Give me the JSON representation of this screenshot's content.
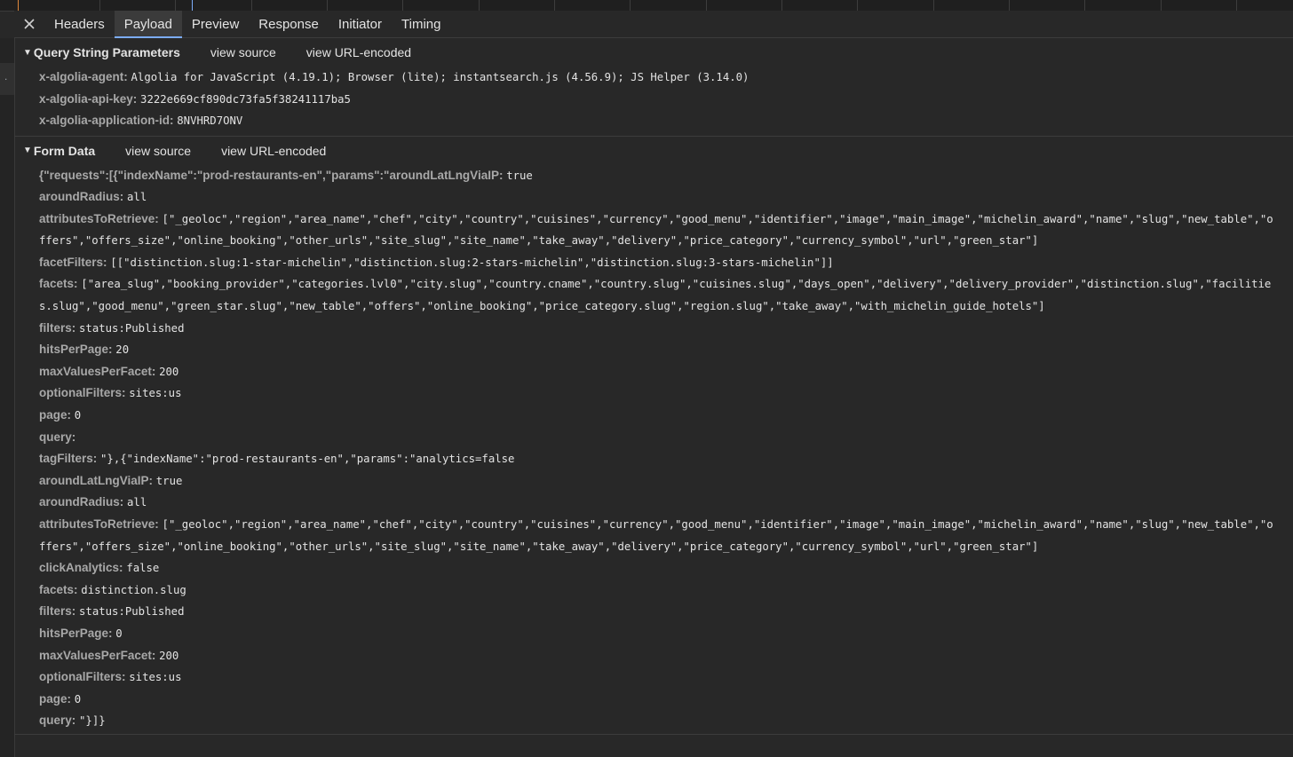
{
  "tabs": {
    "close_icon": "close-icon",
    "items": [
      "Headers",
      "Payload",
      "Preview",
      "Response",
      "Initiator",
      "Timing"
    ],
    "active": "Payload"
  },
  "query_string": {
    "title": "Query String Parameters",
    "view_source": "view source",
    "view_url_encoded": "view URL-encoded",
    "params": [
      {
        "key": "x-algolia-agent:",
        "value": "Algolia for JavaScript (4.19.1); Browser (lite); instantsearch.js (4.56.9); JS Helper (3.14.0)"
      },
      {
        "key": "x-algolia-api-key:",
        "value": "3222e669cf890dc73fa5f38241117ba5"
      },
      {
        "key": "x-algolia-application-id:",
        "value": "8NVHRD7ONV"
      }
    ]
  },
  "form_data": {
    "title": "Form Data",
    "view_source": "view source",
    "view_url_encoded": "view URL-encoded",
    "rows": [
      {
        "key": "{\"requests\":[{\"indexName\":\"prod-restaurants-en\",\"params\":\"aroundLatLngViaIP:",
        "value": "true"
      },
      {
        "key": "aroundRadius:",
        "value": "all"
      },
      {
        "key": "attributesToRetrieve:",
        "value": "[\"_geoloc\",\"region\",\"area_name\",\"chef\",\"city\",\"country\",\"cuisines\",\"currency\",\"good_menu\",\"identifier\",\"image\",\"main_image\",\"michelin_award\",\"name\",\"slug\",\"new_table\",\"o",
        "cont": "ffers\",\"offers_size\",\"online_booking\",\"other_urls\",\"site_slug\",\"site_name\",\"take_away\",\"delivery\",\"price_category\",\"currency_symbol\",\"url\",\"green_star\"]"
      },
      {
        "key": "facetFilters:",
        "value": "[[\"distinction.slug:1-star-michelin\",\"distinction.slug:2-stars-michelin\",\"distinction.slug:3-stars-michelin\"]]"
      },
      {
        "key": "facets:",
        "value": "[\"area_slug\",\"booking_provider\",\"categories.lvl0\",\"city.slug\",\"country.cname\",\"country.slug\",\"cuisines.slug\",\"days_open\",\"delivery\",\"delivery_provider\",\"distinction.slug\",\"facilitie",
        "cont": "s.slug\",\"good_menu\",\"green_star.slug\",\"new_table\",\"offers\",\"online_booking\",\"price_category.slug\",\"region.slug\",\"take_away\",\"with_michelin_guide_hotels\"]"
      },
      {
        "key": "filters:",
        "value": "status:Published"
      },
      {
        "key": "hitsPerPage:",
        "value": "20"
      },
      {
        "key": "maxValuesPerFacet:",
        "value": "200"
      },
      {
        "key": "optionalFilters:",
        "value": "sites:us"
      },
      {
        "key": "page:",
        "value": "0"
      },
      {
        "key": "query:",
        "value": ""
      },
      {
        "key": "tagFilters:",
        "value": "\"},{\"indexName\":\"prod-restaurants-en\",\"params\":\"analytics=false"
      },
      {
        "key": "aroundLatLngViaIP:",
        "value": "true"
      },
      {
        "key": "aroundRadius:",
        "value": "all"
      },
      {
        "key": "attributesToRetrieve:",
        "value": "[\"_geoloc\",\"region\",\"area_name\",\"chef\",\"city\",\"country\",\"cuisines\",\"currency\",\"good_menu\",\"identifier\",\"image\",\"main_image\",\"michelin_award\",\"name\",\"slug\",\"new_table\",\"o",
        "cont": "ffers\",\"offers_size\",\"online_booking\",\"other_urls\",\"site_slug\",\"site_name\",\"take_away\",\"delivery\",\"price_category\",\"currency_symbol\",\"url\",\"green_star\"]"
      },
      {
        "key": "clickAnalytics:",
        "value": "false"
      },
      {
        "key": "facets:",
        "value": "distinction.slug"
      },
      {
        "key": "filters:",
        "value": "status:Published"
      },
      {
        "key": "hitsPerPage:",
        "value": "0"
      },
      {
        "key": "maxValuesPerFacet:",
        "value": "200"
      },
      {
        "key": "optionalFilters:",
        "value": "sites:us"
      },
      {
        "key": "page:",
        "value": "0"
      },
      {
        "key": "query:",
        "value": "\"}]}"
      }
    ]
  }
}
